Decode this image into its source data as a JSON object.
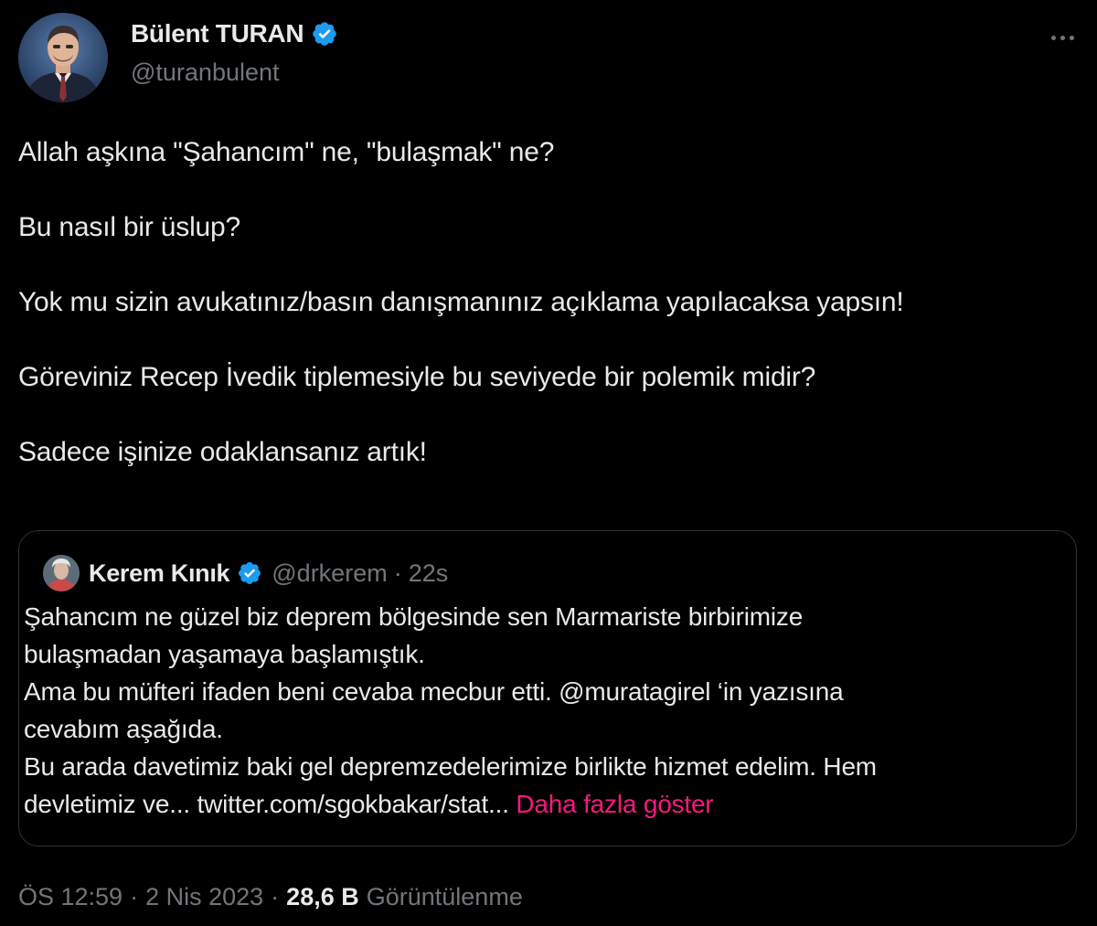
{
  "author": {
    "name": "Bülent TURAN",
    "handle": "@turanbulent",
    "avatar_icon": "profile-photo",
    "verified_icon": "verified-badge-icon"
  },
  "menu_icon": "more-options-icon",
  "tweet_paragraphs": [
    "Allah aşkına \"Şahancım\" ne, \"bulaşmak\" ne?",
    "Bu nasıl bir üslup?",
    "Yok mu sizin avukatınız/basın danışmanınız açıklama yapılacaksa yapsın!",
    "Göreviniz Recep İvedik tiplemesiyle bu seviyede bir polemik midir?",
    "Sadece işinize odaklansanız artık!"
  ],
  "quoted_tweet": {
    "name": "Kerem Kınık",
    "handle": "@drkerem",
    "separator": "·",
    "time": "22s",
    "lines": [
      "Şahancım ne güzel biz deprem bölgesinde sen Marmariste birbirimize",
      "bulaşmadan yaşamaya başlamıştık.",
      "Ama bu müfteri ifaden beni cevaba mecbur etti. @muratagirel ‘in yazısına",
      "cevabım aşağıda.",
      "Bu arada davetimiz baki gel depremzedelerimize birlikte hizmet edelim. Hem"
    ],
    "last_line": "devletimiz ve... twitter.com/sgokbakar/stat...",
    "show_more": "Daha fazla göster"
  },
  "meta": {
    "time": "ÖS 12:59",
    "separator": "·",
    "date": "2 Nis 2023",
    "views_count": "28,6 B",
    "views_label": "Görüntülenme"
  },
  "colors": {
    "background": "#000000",
    "text": "#e7e9ea",
    "secondary": "#71767b",
    "border": "#2f3336",
    "verified": "#1d9bf0",
    "link": "#f91880"
  }
}
